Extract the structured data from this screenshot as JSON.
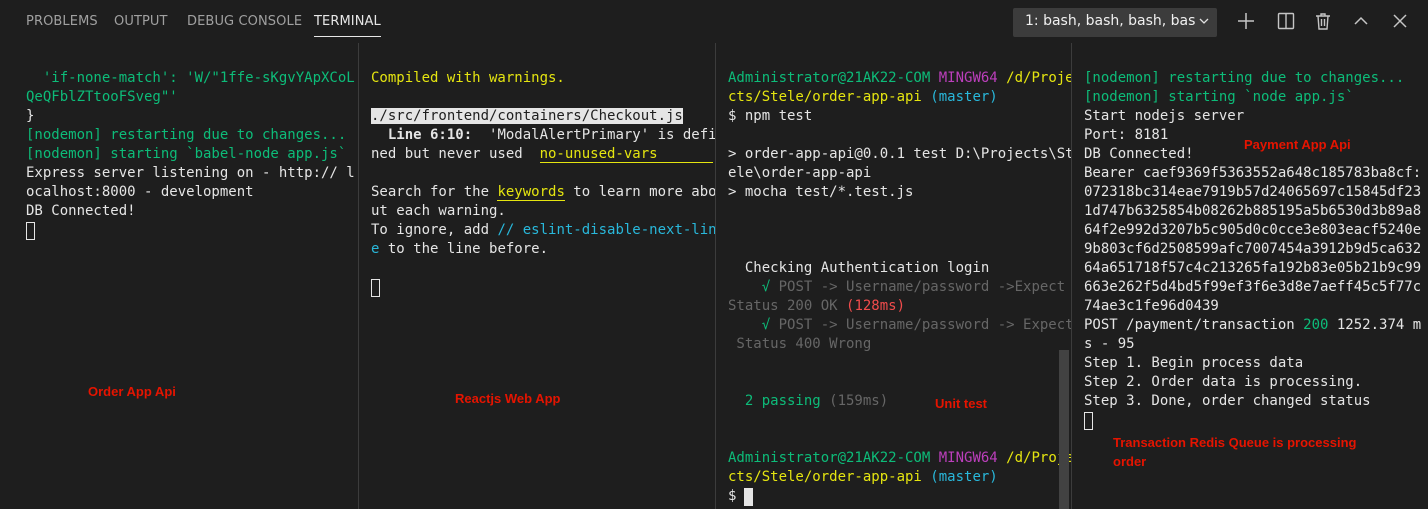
{
  "tabs": [
    {
      "label": "PROBLEMS"
    },
    {
      "label": "OUTPUT"
    },
    {
      "label": "DEBUG CONSOLE"
    },
    {
      "label": "TERMINAL"
    }
  ],
  "terminal_select": {
    "value": "1: bash, bash, bash, bas"
  },
  "toolbar": {
    "add_icon": "plus-icon",
    "split_icon": "split-icon",
    "trash_icon": "trash-icon",
    "maximize_icon": "chevron-up-icon",
    "close_icon": "close-icon"
  },
  "pane1": {
    "lines": [
      "  'if-none-match': 'W/\"1ffe-sKgvYApXCoL",
      "QeQFblZTtooFSveg\"'",
      "}",
      "[nodemon] restarting due to changes...",
      "[nodemon] starting `babel-node app.js`",
      "Express server listening on - http:// l",
      "ocalhost:8000 - development",
      "DB Connected!"
    ],
    "note": "Order App Api"
  },
  "pane2": {
    "compiled": "Compiled with warnings.",
    "file": "./src/frontend/containers/Checkout.js",
    "warn_loc": "  Line 6:10:",
    "warn_msg1": "  'ModalAlertPrimary' is defi",
    "warn_msg2": "ned but never used  ",
    "warn_rule": "no-unused-vars",
    "search_pre": "Search for the ",
    "search_kw": "keywords",
    "search_post": " to learn more abo",
    "search_line2": "ut each warning.",
    "ignore_pre": "To ignore, add ",
    "ignore_code": "// eslint-disable-next-lin",
    "ignore_code2": "e",
    "ignore_post": " to the line before.",
    "note": "Reactjs Web App"
  },
  "pane3": {
    "prompt_user": "Administrator@21AK22-COM",
    "prompt_env": "MINGW64",
    "prompt_path1": " /d/Proje",
    "prompt_path2": "cts/Stele/order-app-api",
    "prompt_branch": " (master)",
    "cmd": "$ npm test",
    "run1": "> order-app-api@0.0.1 test D:\\Projects\\St",
    "run2": "ele\\order-app-api",
    "run3": "> mocha test/*.test.js",
    "suite": "  Checking Authentication login",
    "test1_mark": "    √",
    "test1_a": " POST -> Username/password ->Expect",
    "test1_b": "Status 200 OK ",
    "test1_time": "(128ms)",
    "test2_mark": "    √",
    "test2_a": " POST -> Username/password -> Expect",
    "test2_b": " Status 400 Wrong",
    "passing": "  2 passing",
    "passing_time": " (159ms)",
    "prompt2_user": "Administrator@21AK22-COM",
    "prompt2_env": "MINGW64",
    "prompt2_path1": " /d/Proje",
    "prompt2_path2": "cts/Stele/order-app-api",
    "prompt2_branch": " (master)",
    "prompt2_dollar": "$ ",
    "note": "Unit test"
  },
  "pane4": {
    "nodemon1": "[nodemon] restarting due to changes...",
    "nodemon2": "[nodemon] starting `node app.js`",
    "lines": [
      "Start nodejs server",
      "Port: 8181",
      "DB Connected!",
      "Bearer caef9369f5363552a648c185783ba8cf:",
      "072318bc314eae7919b57d24065697c15845df23",
      "1d747b6325854b08262b885195a5b6530d3b89a8",
      "64f2e992d3207b5c905d0c0cce3e803eacf5240e",
      "9b803cf6d2508599afc7007454a3912b9d5ca632",
      "64a651718f57c4c213265fa192b83e05b21b9c99",
      "663e262f5d4bd5f99ef3f6e3d8e7aeff45c5f77c",
      "74ae3c1fe96d0439"
    ],
    "post_pre": "POST /payment/transaction ",
    "post_code": "200",
    "post_post": " 1252.374 m",
    "post_line2": "s - 95",
    "steps": [
      "Step 1. Begin process data",
      "Step 2. Order data is processing.",
      "Step 3. Done, order changed status"
    ],
    "note_top": "Payment App Api",
    "note_bottom1": "Transaction Redis Queue is processing",
    "note_bottom2": "order"
  }
}
